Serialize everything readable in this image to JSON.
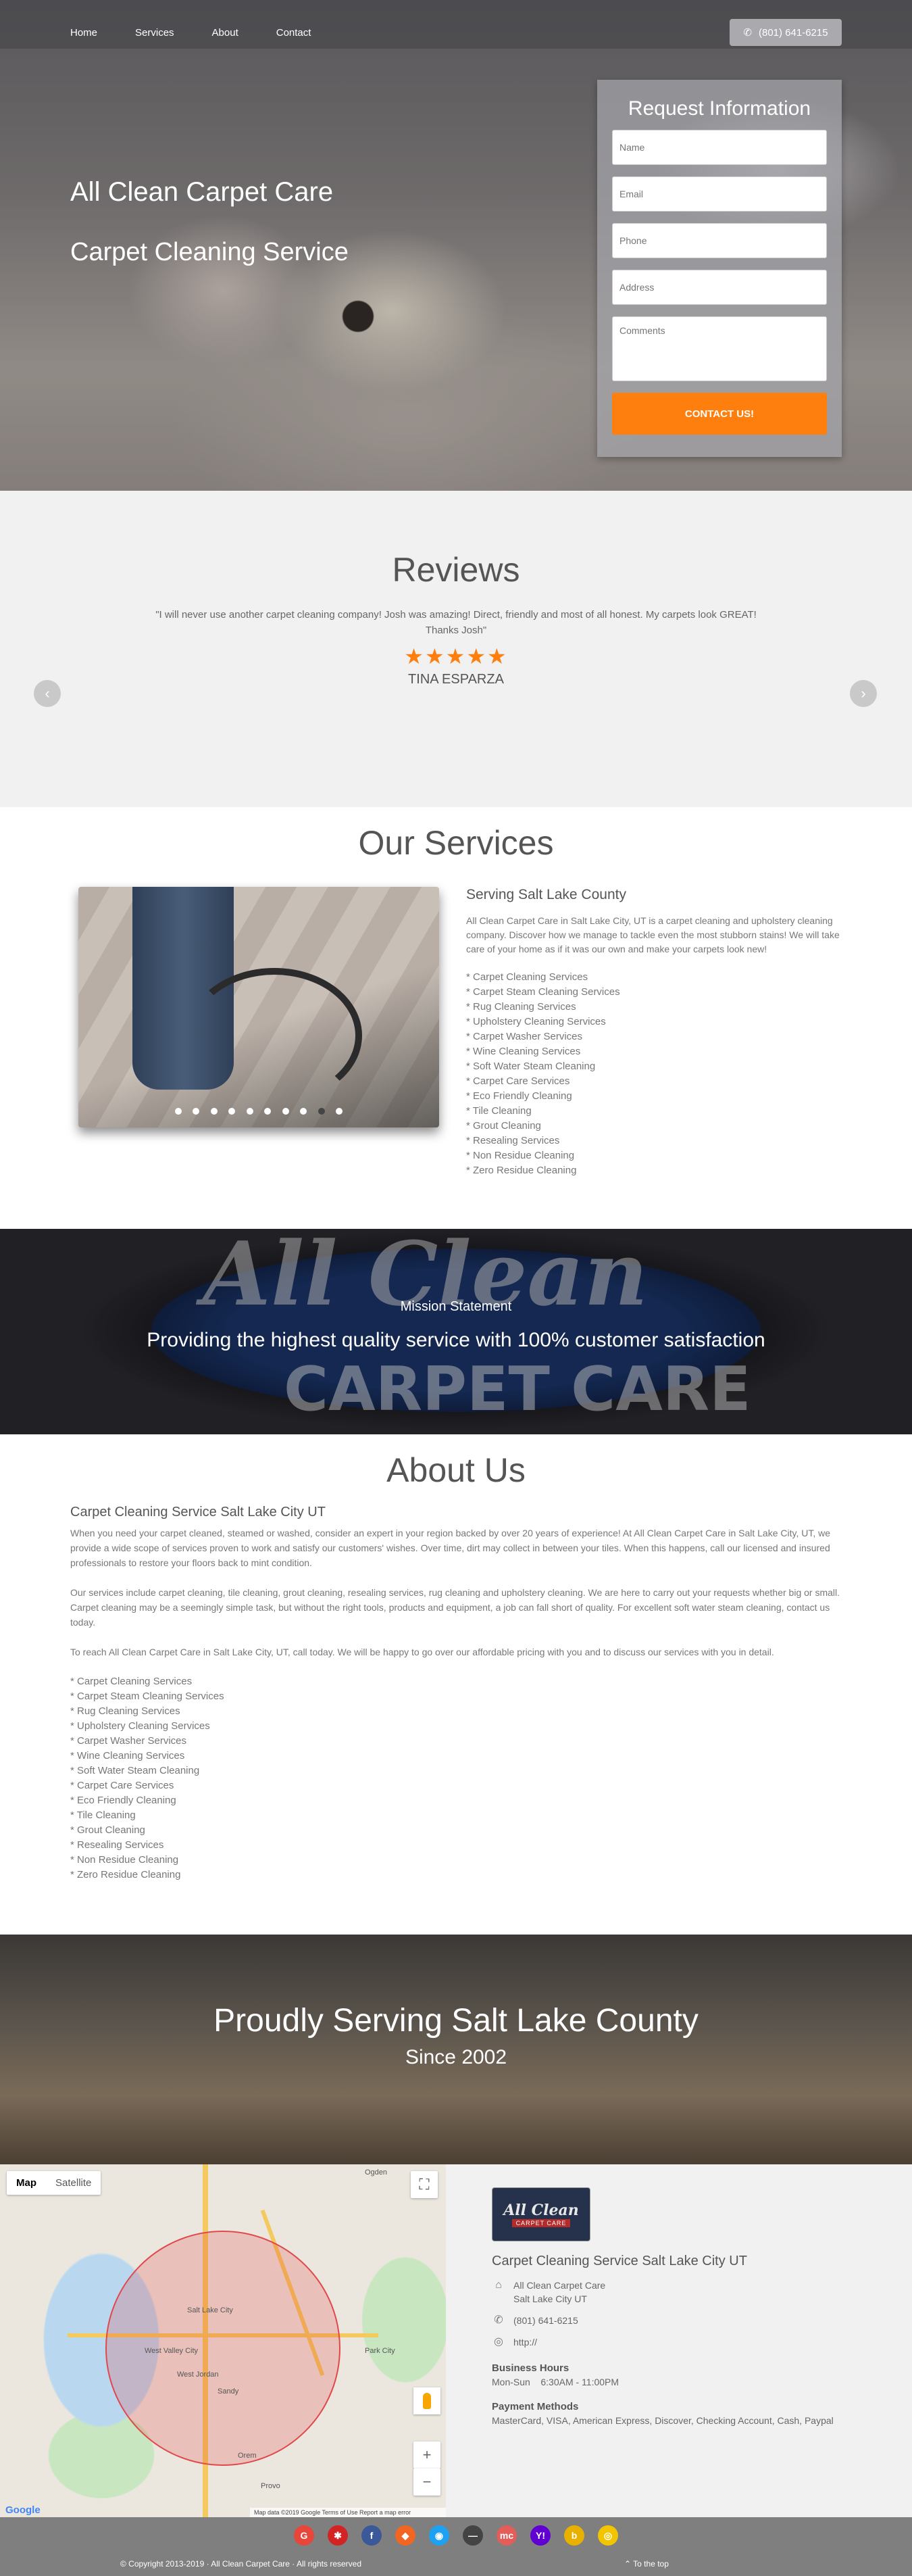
{
  "nav": {
    "items": [
      "Home",
      "Services",
      "About",
      "Contact"
    ],
    "phone": "(801) 641-6215"
  },
  "hero": {
    "title": "All Clean Carpet Care",
    "subtitle": "Carpet Cleaning Service",
    "form": {
      "title": "Request Information",
      "name_placeholder": "Name",
      "email_placeholder": "Email",
      "phone_placeholder": "Phone",
      "address_placeholder": "Address",
      "comments_placeholder": "Comments",
      "submit_label": "CONTACT US!"
    }
  },
  "reviews": {
    "title": "Reviews",
    "quote": "\"I will never use another carpet cleaning company! Josh was amazing! Direct, friendly and most of all honest. My carpets look GREAT! Thanks Josh\"",
    "stars": "★★★★★",
    "rating": 5,
    "reviewer": "TINA ESPARZA",
    "prev_icon": "‹",
    "next_icon": "›"
  },
  "services": {
    "title": "Our Services",
    "heading": "Serving Salt Lake County",
    "description": "All Clean Carpet Care in Salt Lake City, UT is a carpet cleaning and upholstery cleaning company. Discover how we manage to tackle even the most stubborn stains! We will take care of your home as if it was our own and make your carpets look new!",
    "list": [
      "* Carpet Cleaning Services",
      "* Carpet Steam Cleaning Services",
      "* Rug Cleaning Services",
      "* Upholstery Cleaning Services",
      "* Carpet Washer Services",
      "* Wine Cleaning Services",
      "* Soft Water Steam Cleaning",
      "* Carpet Care Services",
      "* Eco Friendly Cleaning",
      "* Tile Cleaning",
      "* Grout Cleaning",
      "* Resealing Services",
      "* Non Residue Cleaning",
      "* Zero Residue Cleaning"
    ]
  },
  "mission": {
    "logo_text": "All Clean",
    "logo_subtext": "CARPET CARE",
    "label": "Mission Statement",
    "text": "Providing the highest quality service with 100% customer satisfaction"
  },
  "about": {
    "title": "About Us",
    "heading": "Carpet Cleaning Service Salt Lake City UT",
    "p1": "When you need your carpet cleaned, steamed or washed, consider an expert in your region backed by over 20 years of experience! At All Clean Carpet Care in Salt Lake City, UT, we provide a wide scope of services proven to work and satisfy our customers' wishes. Over time, dirt may collect in between your tiles. When this happens, call our licensed and insured professionals to restore your floors back to mint condition.",
    "p2": "Our services include carpet cleaning, tile cleaning, grout cleaning, resealing services, rug cleaning and upholstery cleaning. We are here to carry out your requests whether big or small. Carpet cleaning may be a seemingly simple task, but without the right tools, products and equipment, a job can fall short of quality. For excellent soft water steam cleaning, contact us today.",
    "p3": "To reach All Clean Carpet Care in Salt Lake City, UT, call today. We will be happy to go over our affordable pricing with you and to discuss our services with you in detail.",
    "list": [
      "* Carpet Cleaning Services",
      "* Carpet Steam Cleaning Services",
      "* Rug Cleaning Services",
      "* Upholstery Cleaning Services",
      "* Carpet Washer Services",
      "* Wine Cleaning Services",
      "* Soft Water Steam Cleaning",
      "* Carpet Care Services",
      "* Eco Friendly Cleaning",
      "* Tile Cleaning",
      "* Grout Cleaning",
      "* Resealing Services",
      "* Non Residue Cleaning",
      "* Zero Residue Cleaning"
    ]
  },
  "proudly": {
    "title": "Proudly Serving Salt Lake County",
    "since": "Since 2002"
  },
  "map": {
    "tab_map": "Map",
    "tab_satellite": "Satellite",
    "zoom_in": "+",
    "zoom_out": "−",
    "fullscreen_icon": "⛶",
    "google": "Google",
    "footer": "Map data ©2019 Google   Terms of Use   Report a map error",
    "labels": [
      "Salt Lake City",
      "West Valley City",
      "West Jordan",
      "Sandy",
      "Provo",
      "Orem",
      "Ogden",
      "Park City"
    ]
  },
  "info": {
    "logo_text": "All Clean",
    "logo_subtext": "CARPET CARE",
    "heading": "Carpet Cleaning Service Salt Lake City UT",
    "address_line1": "All Clean Carpet Care",
    "address_line2": "Salt Lake City UT",
    "phone": "(801) 641-6215",
    "website": "http://",
    "hours_title": "Business Hours",
    "hours": "Mon-Sun    6:30AM - 11:00PM",
    "payment_title": "Payment Methods",
    "payment": "MasterCard, VISA, American Express, Discover, Checking Account, Cash, Paypal",
    "icons": {
      "address": "⌂",
      "phone": "✆",
      "web": "◎"
    }
  },
  "footer": {
    "socials": [
      {
        "glyph": "G",
        "color": "#e8463b"
      },
      {
        "glyph": "✱",
        "color": "#d32323"
      },
      {
        "glyph": "f",
        "color": "#3b5998"
      },
      {
        "glyph": "◆",
        "color": "#f26522"
      },
      {
        "glyph": "◉",
        "color": "#1da1f2"
      },
      {
        "glyph": "—",
        "color": "#444444"
      },
      {
        "glyph": "mc",
        "color": "#e35d5b"
      },
      {
        "glyph": "Y!",
        "color": "#6001d2"
      },
      {
        "glyph": "b",
        "color": "#e8b100"
      },
      {
        "glyph": "◎",
        "color": "#f2c500"
      }
    ],
    "copyright": "© Copyright 2013-2019 · All Clean Carpet Care · All rights reserved",
    "to_top": "To the top"
  }
}
